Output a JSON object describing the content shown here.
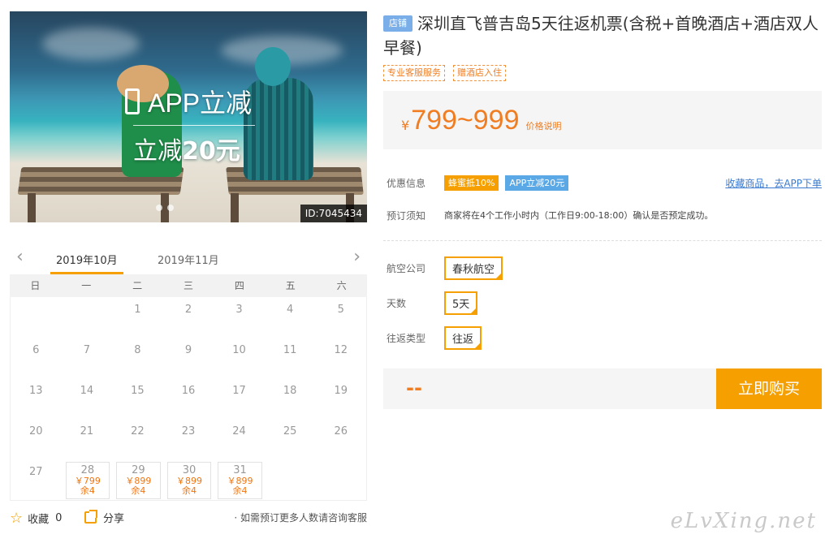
{
  "hero": {
    "promo_line1": "APP立减",
    "promo_line2_prefix": "立减",
    "promo_line2_amount": "20元",
    "id_label": "ID:7045434"
  },
  "calendar": {
    "prev_arrow": "‹",
    "next_arrow": "›",
    "tabs": [
      {
        "label": "2019年10月",
        "active": true
      },
      {
        "label": "2019年11月",
        "active": false
      }
    ],
    "weekdays": [
      "日",
      "一",
      "二",
      "三",
      "四",
      "五",
      "六"
    ],
    "weeks": [
      [
        {
          "d": ""
        },
        {
          "d": ""
        },
        {
          "d": "1"
        },
        {
          "d": "2"
        },
        {
          "d": "3"
        },
        {
          "d": "4"
        },
        {
          "d": "5"
        }
      ],
      [
        {
          "d": "6"
        },
        {
          "d": "7"
        },
        {
          "d": "8"
        },
        {
          "d": "9"
        },
        {
          "d": "10"
        },
        {
          "d": "11"
        },
        {
          "d": "12"
        }
      ],
      [
        {
          "d": "13"
        },
        {
          "d": "14"
        },
        {
          "d": "15"
        },
        {
          "d": "16"
        },
        {
          "d": "17"
        },
        {
          "d": "18"
        },
        {
          "d": "19"
        }
      ],
      [
        {
          "d": "20"
        },
        {
          "d": "21"
        },
        {
          "d": "22"
        },
        {
          "d": "23"
        },
        {
          "d": "24"
        },
        {
          "d": "25"
        },
        {
          "d": "26"
        }
      ],
      [
        {
          "d": "27"
        },
        {
          "d": "28",
          "price": "￥799",
          "stock": "余4"
        },
        {
          "d": "29",
          "price": "￥899",
          "stock": "余4"
        },
        {
          "d": "30",
          "price": "￥899",
          "stock": "余4"
        },
        {
          "d": "31",
          "price": "￥899",
          "stock": "余4"
        },
        {
          "d": ""
        },
        {
          "d": ""
        }
      ]
    ]
  },
  "actions": {
    "favorite_label": "收藏",
    "favorite_count": "0",
    "share_label": "分享",
    "consult_text": "· 如需预订更多人数请咨询客服"
  },
  "product": {
    "shop_badge": "店铺",
    "title": "深圳直飞普吉岛5天往返机票(含税+首晚酒店+酒店双人早餐)",
    "tags": [
      "专业客服服务",
      "赠酒店入住"
    ],
    "currency": "¥",
    "price_range": "799~999",
    "price_explain": "价格说明"
  },
  "info": {
    "discount_label": "优惠信息",
    "discount_badges": [
      {
        "text": "蜂蜜抵10%",
        "color": "#f5a000"
      },
      {
        "text": "APP立减20元",
        "color": "#5aa9e6"
      }
    ],
    "fav_link": "收藏商品，去APP下单",
    "notice_label": "预订须知",
    "notice_text": "商家将在4个工作小时内（工作日9:00-18:00）确认是否预定成功。"
  },
  "options": {
    "airline_label": "航空公司",
    "airline_value": "春秋航空",
    "days_label": "天数",
    "days_value": "5天",
    "trip_label": "往返类型",
    "trip_value": "往返"
  },
  "buy": {
    "total": "--",
    "button_label": "立即购买"
  },
  "watermark": "eLvXing.net",
  "colors": {
    "accent": "#f5a000",
    "price": "#f07d22",
    "link": "#3a7ad0"
  }
}
